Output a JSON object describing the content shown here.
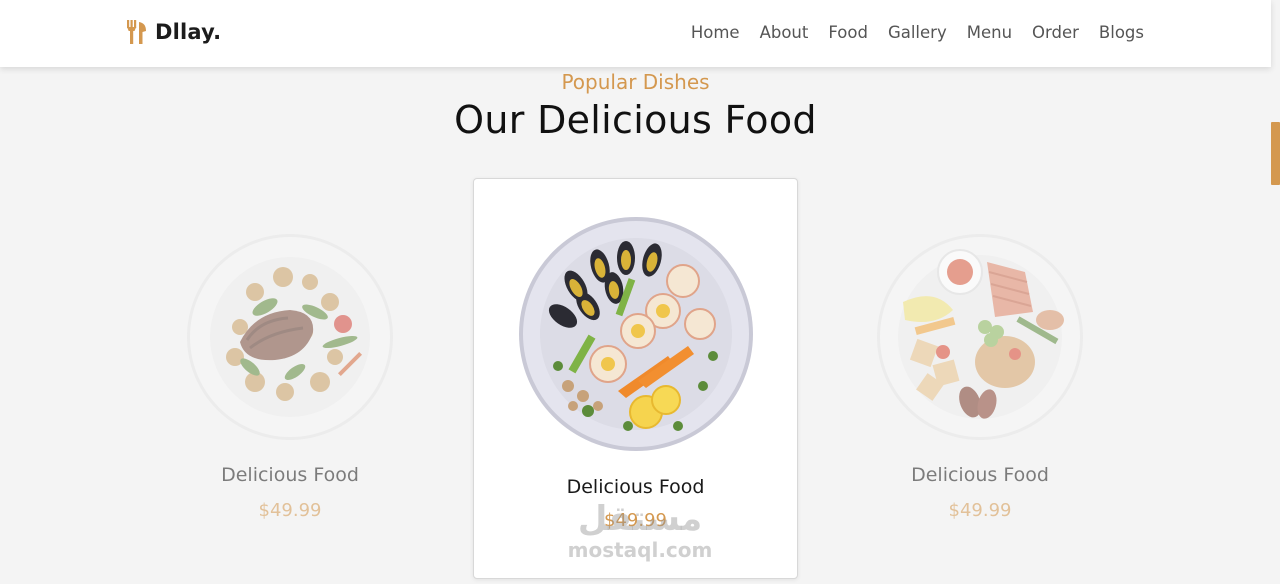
{
  "brand": {
    "name": "Dllay.",
    "icon": "fork-knife-icon",
    "icon_color": "#d4984f"
  },
  "nav": [
    {
      "label": "Home"
    },
    {
      "label": "About"
    },
    {
      "label": "Food"
    },
    {
      "label": "Gallery"
    },
    {
      "label": "Menu"
    },
    {
      "label": "Order"
    },
    {
      "label": "Blogs"
    }
  ],
  "section": {
    "subtitle": "Popular Dishes",
    "title": "Our Delicious Food"
  },
  "dishes": [
    {
      "name": "Delicious Food",
      "price": "$49.99",
      "image": "steak-plate"
    },
    {
      "name": "Delicious Food",
      "price": "$49.99",
      "image": "seafood-platter"
    },
    {
      "name": "Delicious Food",
      "price": "$49.99",
      "image": "mixed-plate"
    }
  ],
  "watermark": {
    "arabic": "مستقل",
    "latin": "mostaql.com"
  },
  "colors": {
    "accent": "#d4984f",
    "background": "#f4f4f4",
    "card": "#ffffff"
  }
}
